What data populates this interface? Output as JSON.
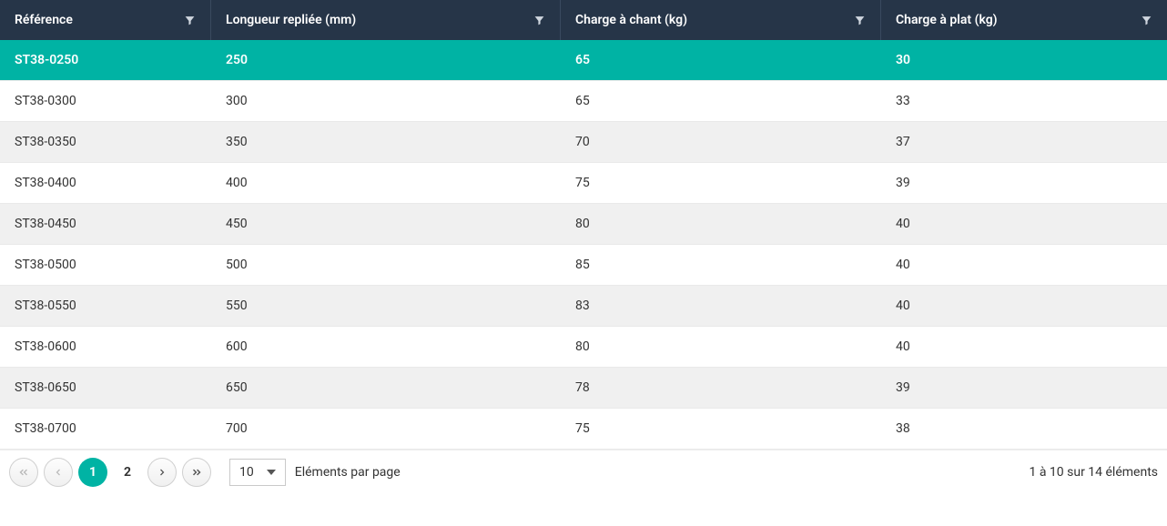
{
  "columns": [
    {
      "key": "ref",
      "label": "Référence"
    },
    {
      "key": "len",
      "label": "Longueur repliée (mm)"
    },
    {
      "key": "chant",
      "label": "Charge à chant (kg)"
    },
    {
      "key": "plat",
      "label": "Charge à plat (kg)"
    }
  ],
  "rows": [
    {
      "ref": "ST38-0250",
      "len": "250",
      "chant": "65",
      "plat": "30",
      "selected": true
    },
    {
      "ref": "ST38-0300",
      "len": "300",
      "chant": "65",
      "plat": "33"
    },
    {
      "ref": "ST38-0350",
      "len": "350",
      "chant": "70",
      "plat": "37"
    },
    {
      "ref": "ST38-0400",
      "len": "400",
      "chant": "75",
      "plat": "39"
    },
    {
      "ref": "ST38-0450",
      "len": "450",
      "chant": "80",
      "plat": "40"
    },
    {
      "ref": "ST38-0500",
      "len": "500",
      "chant": "85",
      "plat": "40"
    },
    {
      "ref": "ST38-0550",
      "len": "550",
      "chant": "83",
      "plat": "40"
    },
    {
      "ref": "ST38-0600",
      "len": "600",
      "chant": "80",
      "plat": "40"
    },
    {
      "ref": "ST38-0650",
      "len": "650",
      "chant": "78",
      "plat": "39"
    },
    {
      "ref": "ST38-0700",
      "len": "700",
      "chant": "75",
      "plat": "38"
    }
  ],
  "pagination": {
    "pages": [
      "1",
      "2"
    ],
    "current_page": "1",
    "page_size_value": "10",
    "page_size_label": "Eléments par page",
    "summary": "1 à 10 sur 14 éléments"
  }
}
